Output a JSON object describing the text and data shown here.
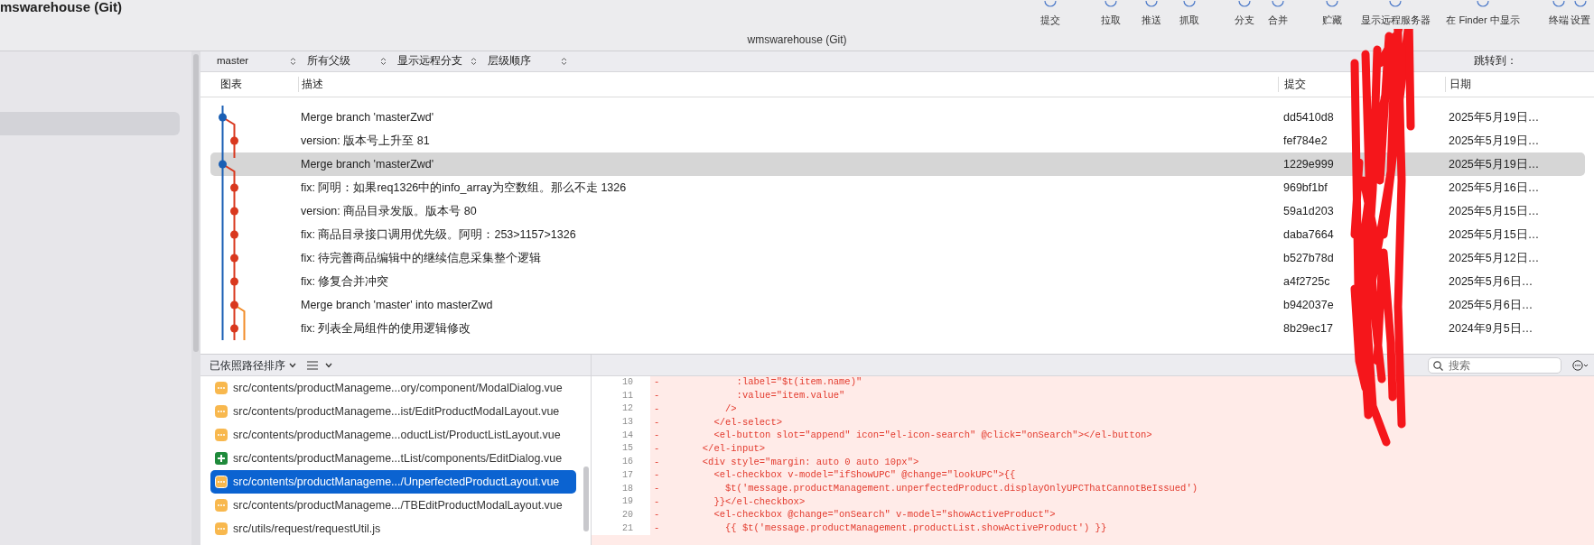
{
  "window": {
    "title_left": "mswarehouse (Git)",
    "title": "wmswarehouse (Git)"
  },
  "toolbar": [
    {
      "label": "提交"
    },
    {
      "label": "拉取"
    },
    {
      "label": "推送"
    },
    {
      "label": "抓取"
    },
    {
      "label": "分支"
    },
    {
      "label": "合并"
    },
    {
      "label": "贮藏"
    },
    {
      "label": "显示远程服务器"
    },
    {
      "label": "在 Finder 中显示"
    },
    {
      "label": "终端"
    },
    {
      "label": "设置"
    }
  ],
  "filters": [
    {
      "label": "master"
    },
    {
      "label": "所有父级"
    },
    {
      "label": "显示远程分支"
    },
    {
      "label": "层级顺序"
    }
  ],
  "jump_label": "跳转到：",
  "columns": {
    "graph": "图表",
    "description": "描述",
    "commit": "提交",
    "date": "日期"
  },
  "commits": [
    {
      "kind": "merge",
      "description": "Merge branch 'masterZwd'",
      "hash": "dd5410d8",
      "date": "2025年5月19日…",
      "selected": false
    },
    {
      "kind": "commit",
      "description": "version: 版本号上升至 81",
      "hash": "fef784e2",
      "date": "2025年5月19日…",
      "selected": false
    },
    {
      "kind": "merge",
      "description": "Merge branch 'masterZwd'",
      "hash": "1229e999",
      "date": "2025年5月19日…",
      "selected": true
    },
    {
      "kind": "commit",
      "description": "fix: 阿明：如果req1326中的info_array为空数组。那么不走 1326",
      "hash": "969bf1bf",
      "date": "2025年5月16日…",
      "selected": false
    },
    {
      "kind": "commit",
      "description": "version: 商品目录发版。版本号 80",
      "hash": "59a1d203",
      "date": "2025年5月15日…",
      "selected": false
    },
    {
      "kind": "commit",
      "description": "fix: 商品目录接口调用优先级。阿明：253>1157>1326",
      "hash": "daba7664",
      "date": "2025年5月15日…",
      "selected": false
    },
    {
      "kind": "commit",
      "description": "fix: 待完善商品编辑中的继续信息采集整个逻辑",
      "hash": "b527b78d",
      "date": "2025年5月12日…",
      "selected": false
    },
    {
      "kind": "commit",
      "description": "fix: 修复合并冲突",
      "hash": "a4f2725c",
      "date": "2025年5月6日…",
      "selected": false
    },
    {
      "kind": "branch",
      "description": "Merge branch 'master' into masterZwd",
      "hash": "b942037e",
      "date": "2025年5月6日…",
      "selected": false
    },
    {
      "kind": "commit",
      "description": "fix: 列表全局组件的使用逻辑修改",
      "hash": "8b29ec17",
      "date": "2024年9月5日…",
      "selected": false
    }
  ],
  "file_list": {
    "sort_label": "已依照路径排序",
    "files": [
      {
        "kind": "modified",
        "path": "src/contents/productManageme...ory/component/ModalDialog.vue",
        "selected": false
      },
      {
        "kind": "modified",
        "path": "src/contents/productManageme...ist/EditProductModalLayout.vue",
        "selected": false
      },
      {
        "kind": "modified",
        "path": "src/contents/productManageme...oductList/ProductListLayout.vue",
        "selected": false
      },
      {
        "kind": "added",
        "path": "src/contents/productManageme...tList/components/EditDialog.vue",
        "selected": false
      },
      {
        "kind": "modified",
        "path": "src/contents/productManageme.../UnperfectedProductLayout.vue",
        "selected": true
      },
      {
        "kind": "modified",
        "path": "src/contents/productManageme.../TBEditProductModalLayout.vue",
        "selected": false
      },
      {
        "kind": "modified",
        "path": "src/utils/request/requestUtil.js",
        "selected": false
      }
    ]
  },
  "diff": {
    "search": {
      "placeholder": "搜索"
    },
    "lines": [
      {
        "number": "10",
        "marker": "-",
        "text": "            :label=\"$t(item.name)\""
      },
      {
        "number": "11",
        "marker": "-",
        "text": "            :value=\"item.value\""
      },
      {
        "number": "12",
        "marker": "-",
        "text": "          />"
      },
      {
        "number": "13",
        "marker": "-",
        "text": "        </el-select>"
      },
      {
        "number": "14",
        "marker": "-",
        "text": "        <el-button slot=\"append\" icon=\"el-icon-search\" @click=\"onSearch\"></el-button>"
      },
      {
        "number": "15",
        "marker": "-",
        "text": "      </el-input>"
      },
      {
        "number": "16",
        "marker": "-",
        "text": "      <div style=\"margin: auto 0 auto 10px\">"
      },
      {
        "number": "17",
        "marker": "-",
        "text": "        <el-checkbox v-model=\"ifShowUPC\" @change=\"lookUPC\">{{"
      },
      {
        "number": "18",
        "marker": "-",
        "text": "          $t('message.productManagement.unperfectedProduct.displayOnlyUPCThatCannotBeIssued')"
      },
      {
        "number": "19",
        "marker": "-",
        "text": "        }}</el-checkbox>"
      },
      {
        "number": "20",
        "marker": "-",
        "text": "        <el-checkbox @change=\"onSearch\" v-model=\"showActiveProduct\">"
      },
      {
        "number": "21",
        "marker": "-",
        "text": "          {{ $t('message.productManagement.productList.showActiveProduct') }}"
      }
    ]
  }
}
